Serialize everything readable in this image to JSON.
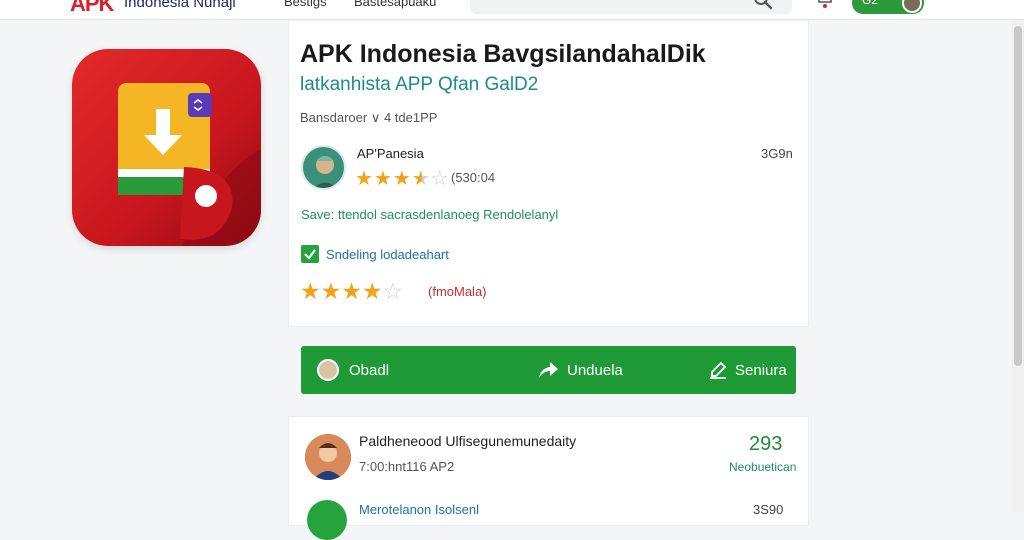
{
  "topbar": {
    "brand": "APK",
    "brand_sub": "Indonesia Nunaji",
    "nav": [
      "Bestigs",
      "Bastesapuaku"
    ],
    "search_icon": "search-icon",
    "bell_icon": "bell-icon",
    "user_label": "G2"
  },
  "app": {
    "title": "APK Indonesia BavgsilandahalDik",
    "subtitle": "latkanhista APP Qfan GalD2",
    "developer_line": "Bansdaroer ∨ 4 tde1PP",
    "developer": {
      "name": "AP'Panesia",
      "count": "3G9n",
      "rating_count": "(530:04",
      "rating": 3.5
    },
    "tagline": "Save: ttendol sacrasdenlanoeg Rendolelanyl",
    "verified_label": "Sndeling lodadeahart",
    "rating": {
      "value": 4,
      "max": 5,
      "label": "(fmoMala)"
    }
  },
  "actions": [
    {
      "label": "Obadl",
      "icon": "avatar-icon"
    },
    {
      "label": "Unduela",
      "icon": "share-icon"
    },
    {
      "label": "Seniura",
      "icon": "edit-icon"
    }
  ],
  "listing": [
    {
      "title": "Paldheneood Ulfisegunemunedaity",
      "meta": "7:00:hnt116 AP2",
      "number": "293",
      "label": "Neobuetican"
    },
    {
      "title": "Merotelanon Isolsenl",
      "number": "3S90"
    }
  ],
  "colors": {
    "accent": "#1f9a37",
    "brand": "#d9202a",
    "star": "#f2a31b",
    "link": "#1d6fa8"
  }
}
